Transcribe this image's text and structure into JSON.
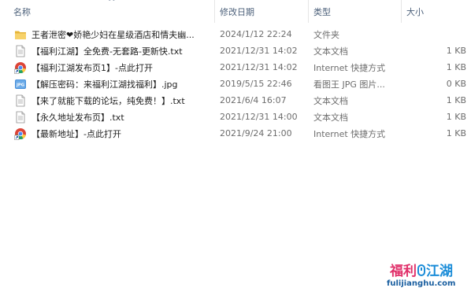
{
  "columns": {
    "name": "名称",
    "date": "修改日期",
    "type": "类型",
    "size": "大小"
  },
  "files": [
    {
      "icon": "folder-icon",
      "name": "王者泄密❤娇艳少妇在星级酒店和情夫幽...",
      "date": "2024/1/12 22:24",
      "type": "文件夹",
      "size": ""
    },
    {
      "icon": "text-file-icon",
      "name": "【福利江湖】全免费-无套路-更新快.txt",
      "date": "2021/12/31 14:02",
      "type": "文本文档",
      "size": "1 KB"
    },
    {
      "icon": "internet-shortcut-icon",
      "name": "【福利江湖发布页1】-点此打开",
      "date": "2021/12/31 14:02",
      "type": "Internet 快捷方式",
      "size": "1 KB"
    },
    {
      "icon": "jpg-image-icon",
      "name": "【解压密码：来福利江湖找福利】.jpg",
      "date": "2019/5/15 22:46",
      "type": "看图王 JPG 图片...",
      "size": "0 KB"
    },
    {
      "icon": "text-file-icon",
      "name": "【来了就能下载的论坛，纯免费！】.txt",
      "date": "2021/6/4 16:07",
      "type": "文本文档",
      "size": "1 KB"
    },
    {
      "icon": "text-file-icon",
      "name": "【永久地址发布页】.txt",
      "date": "2021/12/31 14:00",
      "type": "文本文档",
      "size": "1 KB"
    },
    {
      "icon": "internet-shortcut-icon",
      "name": "【最新地址】-点此打开",
      "date": "2021/9/24 21:00",
      "type": "Internet 快捷方式",
      "size": "1 KB"
    }
  ],
  "watermark": {
    "title_part1": "福利",
    "title_part2": "江湖",
    "url": "fulijianghu.com"
  }
}
